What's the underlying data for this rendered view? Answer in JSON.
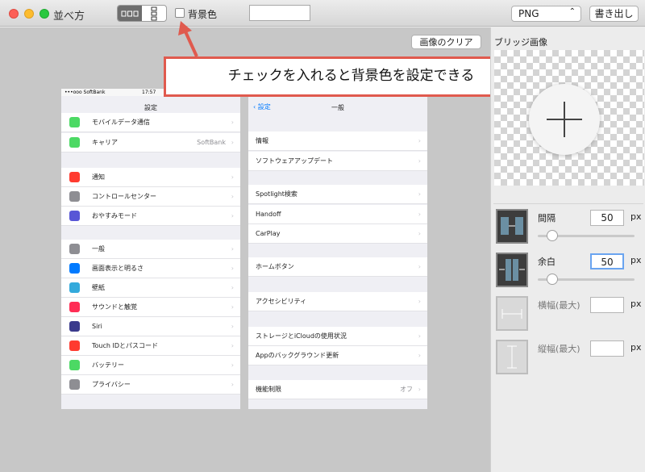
{
  "window": {
    "title": "並べ方"
  },
  "toolbar": {
    "bg_color_label": "背景色",
    "format_value": "PNG",
    "export_label": "書き出し"
  },
  "canvas": {
    "clear_label": "画像のクリア",
    "callout_text": "チェックを入れると背景色を設定できる"
  },
  "left_screen": {
    "status_left": "•••ooo SoftBank",
    "status_time": "17:57",
    "nav_title": "設定",
    "rows": [
      {
        "label": "モバイルデータ通信",
        "value": "",
        "color": "#4cd964"
      },
      {
        "label": "キャリア",
        "value": "SoftBank",
        "color": "#4cd964"
      },
      {
        "label": "通知",
        "value": "",
        "color": "#ff3b30"
      },
      {
        "label": "コントロールセンター",
        "value": "",
        "color": "#8e8e93"
      },
      {
        "label": "おやすみモード",
        "value": "",
        "color": "#5856d6"
      },
      {
        "label": "一般",
        "value": "",
        "color": "#8e8e93"
      },
      {
        "label": "画面表示と明るさ",
        "value": "",
        "color": "#007aff"
      },
      {
        "label": "壁紙",
        "value": "",
        "color": "#34aadc"
      },
      {
        "label": "サウンドと触覚",
        "value": "",
        "color": "#ff2d55"
      },
      {
        "label": "Siri",
        "value": "",
        "color": "#3a3a8c"
      },
      {
        "label": "Touch IDとパスコード",
        "value": "",
        "color": "#ff3b30"
      },
      {
        "label": "バッテリー",
        "value": "",
        "color": "#4cd964"
      },
      {
        "label": "プライバシー",
        "value": "",
        "color": "#8e8e93"
      }
    ]
  },
  "right_screen": {
    "back_label": "設定",
    "nav_title": "一般",
    "rows": [
      {
        "label": "情報",
        "value": ""
      },
      {
        "label": "ソフトウェアアップデート",
        "value": ""
      },
      {
        "label": "Spotlight検索",
        "value": ""
      },
      {
        "label": "Handoff",
        "value": ""
      },
      {
        "label": "CarPlay",
        "value": ""
      },
      {
        "label": "ホームボタン",
        "value": ""
      },
      {
        "label": "アクセシビリティ",
        "value": ""
      },
      {
        "label": "ストレージとiCloudの使用状況",
        "value": ""
      },
      {
        "label": "Appのバックグラウンド更新",
        "value": ""
      },
      {
        "label": "機能制限",
        "value": "オフ"
      }
    ]
  },
  "sidebar": {
    "title": "ブリッジ画像",
    "params": [
      {
        "label": "間隔",
        "value": "50",
        "unit": "px",
        "slider": 0.1
      },
      {
        "label": "余白",
        "value": "50",
        "unit": "px",
        "slider": 0.1
      },
      {
        "label": "横幅(最大)",
        "value": "",
        "unit": "px"
      },
      {
        "label": "縦幅(最大)",
        "value": "",
        "unit": "px"
      }
    ]
  }
}
